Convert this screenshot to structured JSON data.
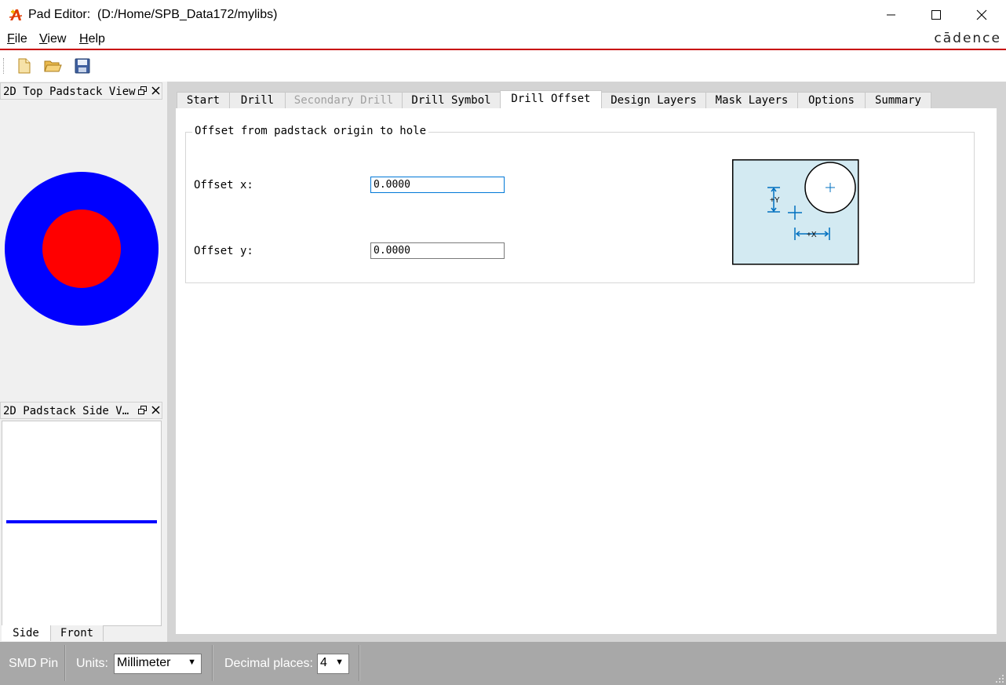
{
  "window": {
    "app_name": "Pad Editor:",
    "path": "(D:/Home/SPB_Data172/mylibs)",
    "brand": "cādence"
  },
  "menu": [
    {
      "key": "F",
      "rest": "ile"
    },
    {
      "key": "V",
      "rest": "iew"
    },
    {
      "key": "H",
      "rest": "elp"
    }
  ],
  "toolbar": {
    "icons": [
      "new-file-icon",
      "open-folder-icon",
      "save-icon"
    ]
  },
  "left_panels": {
    "top_view": {
      "title": "2D Top Padstack View",
      "pad_color": "#0000ff",
      "drill_color": "#ff0000"
    },
    "side_view": {
      "title": "2D Padstack Side V…",
      "layer_color": "#0000ff"
    },
    "side_tabs": [
      "Side",
      "Front"
    ]
  },
  "tabs": [
    "Start",
    "Drill",
    "Secondary Drill",
    "Drill Symbol",
    "Drill Offset",
    "Design Layers",
    "Mask Layers",
    "Options",
    "Summary"
  ],
  "active_tab": "Drill Offset",
  "drill_offset": {
    "group_title": "Offset from padstack origin to hole",
    "offset_x": {
      "label": "Offset x:",
      "value": "0.0000"
    },
    "offset_y": {
      "label": "Offset y:",
      "value": "0.0000"
    },
    "diagram": {
      "label_y": "+Y",
      "label_x": "+X",
      "bg_color": "#d3eaf2",
      "accent": "#0070c0"
    }
  },
  "status": {
    "pin_type": "SMD Pin",
    "units_label": "Units:",
    "units_value": "Millimeter",
    "decimal_label": "Decimal places:",
    "decimal_value": "4"
  }
}
